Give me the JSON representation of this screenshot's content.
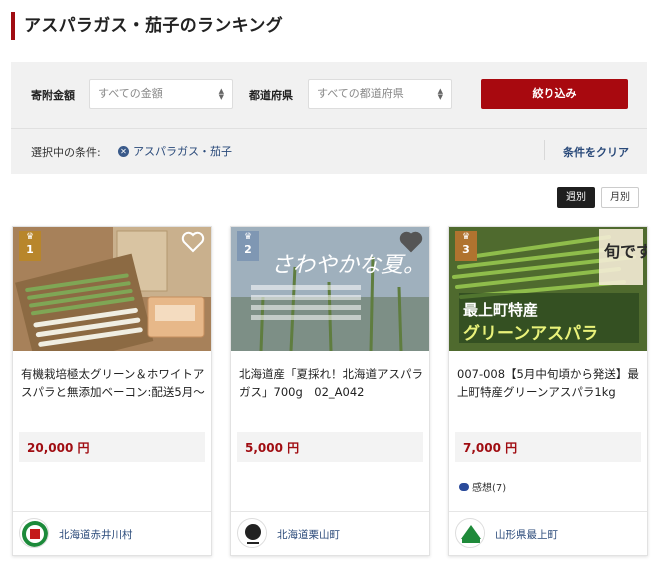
{
  "page": {
    "title": "アスパラガス・茄子のランキング"
  },
  "filters": {
    "amount_label": "寄附金額",
    "amount_value": "すべての金額",
    "prefecture_label": "都道府県",
    "prefecture_value": "すべての都道府県",
    "search_button": "絞り込み",
    "conditions_label": "選択中の条件:",
    "selected_condition": "アスパラガス・茄子",
    "clear_label": "条件をクリア"
  },
  "period_tabs": [
    {
      "label": "週別",
      "active": true
    },
    {
      "label": "月別",
      "active": false
    }
  ],
  "products": [
    {
      "rank": "1",
      "title": "有機栽培極太グリーン＆ホワイトアスパラと無添加ベーコン:配送5月〜",
      "price": "20,000 円",
      "review": "",
      "municipality": "北海道赤井川村",
      "badge_color": "#b8862b"
    },
    {
      "rank": "2",
      "title": "北海道産「夏採れ！北海道アスパラガス」700g　02_A042",
      "price": "5,000 円",
      "review": "",
      "municipality": "北海道栗山町",
      "badge_color": "#7f97b3",
      "image_text": {
        "headline": "さわやかな夏。"
      }
    },
    {
      "rank": "3",
      "title": "007-008【5月中旬頃から発送】最上町特産グリーンアスパラ1kg",
      "price": "7,000 円",
      "review": "感想(7)",
      "municipality": "山形県最上町",
      "badge_color": "#b0732f",
      "image_text": {
        "banner_line1": "最上町特産",
        "banner_line2": "グリーンアスパラ",
        "stamp": "旬です！"
      }
    }
  ]
}
